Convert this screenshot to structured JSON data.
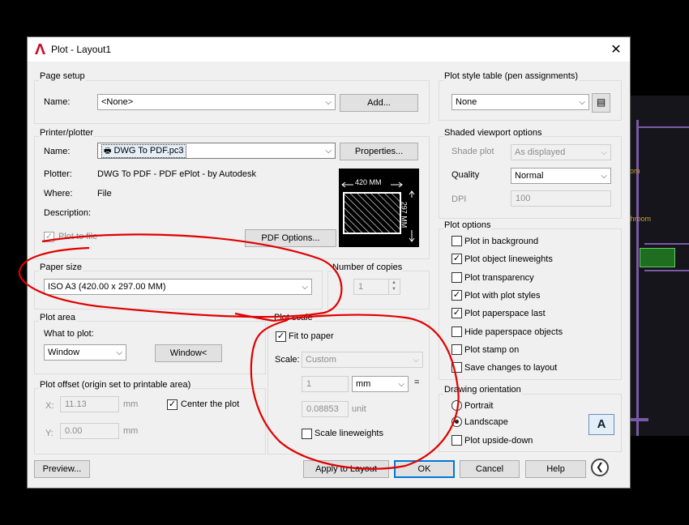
{
  "window": {
    "title": "Plot - Layout1"
  },
  "page_setup": {
    "group": "Page setup",
    "name_label": "Name:",
    "name_value": "<None>",
    "add_button": "Add..."
  },
  "printer": {
    "group": "Printer/plotter",
    "name_label": "Name:",
    "name_value": "DWG To PDF.pc3",
    "properties_button": "Properties...",
    "plotter_label": "Plotter:",
    "plotter_value": "DWG To PDF - PDF ePlot - by Autodesk",
    "where_label": "Where:",
    "where_value": "File",
    "description_label": "Description:",
    "plot_to_file": "Plot to file",
    "pdf_options_button": "PDF Options...",
    "preview_width": "420 MM",
    "preview_height": "297 MM"
  },
  "paper_size": {
    "group": "Paper size",
    "value": "ISO A3 (420.00 x 297.00 MM)"
  },
  "copies": {
    "group": "Number of copies",
    "value": "1"
  },
  "plot_area": {
    "group": "Plot area",
    "what_label": "What to plot:",
    "what_value": "Window",
    "window_button": "Window<"
  },
  "plot_offset": {
    "group": "Plot offset (origin set to printable area)",
    "x_label": "X:",
    "x_value": "11.13",
    "x_unit": "mm",
    "y_label": "Y:",
    "y_value": "0.00",
    "y_unit": "mm",
    "center_label": "Center the plot",
    "center_checked": true
  },
  "plot_scale": {
    "group": "Plot scale",
    "fit_label": "Fit to paper",
    "fit_checked": true,
    "scale_label": "Scale:",
    "scale_value": "Custom",
    "value1": "1",
    "unit1": "mm",
    "equals": "=",
    "value2": "0.08853",
    "unit2": "unit",
    "lineweights_label": "Scale lineweights"
  },
  "plot_style": {
    "group": "Plot style table (pen assignments)",
    "value": "None"
  },
  "shaded": {
    "group": "Shaded viewport options",
    "shade_label": "Shade plot",
    "shade_value": "As displayed",
    "quality_label": "Quality",
    "quality_value": "Normal",
    "dpi_label": "DPI",
    "dpi_value": "100"
  },
  "plot_options": {
    "group": "Plot options",
    "items": [
      {
        "label": "Plot in background",
        "checked": false
      },
      {
        "label": "Plot object lineweights",
        "checked": true
      },
      {
        "label": "Plot transparency",
        "checked": false
      },
      {
        "label": "Plot with plot styles",
        "checked": true
      },
      {
        "label": "Plot paperspace last",
        "checked": true
      },
      {
        "label": "Hide paperspace objects",
        "checked": false
      },
      {
        "label": "Plot stamp on",
        "checked": false
      },
      {
        "label": "Save changes to layout",
        "checked": false
      }
    ]
  },
  "orientation": {
    "group": "Drawing orientation",
    "portrait": "Portrait",
    "landscape": "Landscape",
    "upside_down": "Plot upside-down",
    "selected": "landscape",
    "icon_letter": "A"
  },
  "footer": {
    "preview": "Preview...",
    "apply": "Apply to Layout",
    "ok": "OK",
    "cancel": "Cancel",
    "help": "Help"
  },
  "background": {
    "label1": "om",
    "label2": "throom"
  },
  "colors": {
    "accent": "#0078d7",
    "annotation": "#e00000",
    "cad_wall": "#7a5aa6"
  }
}
